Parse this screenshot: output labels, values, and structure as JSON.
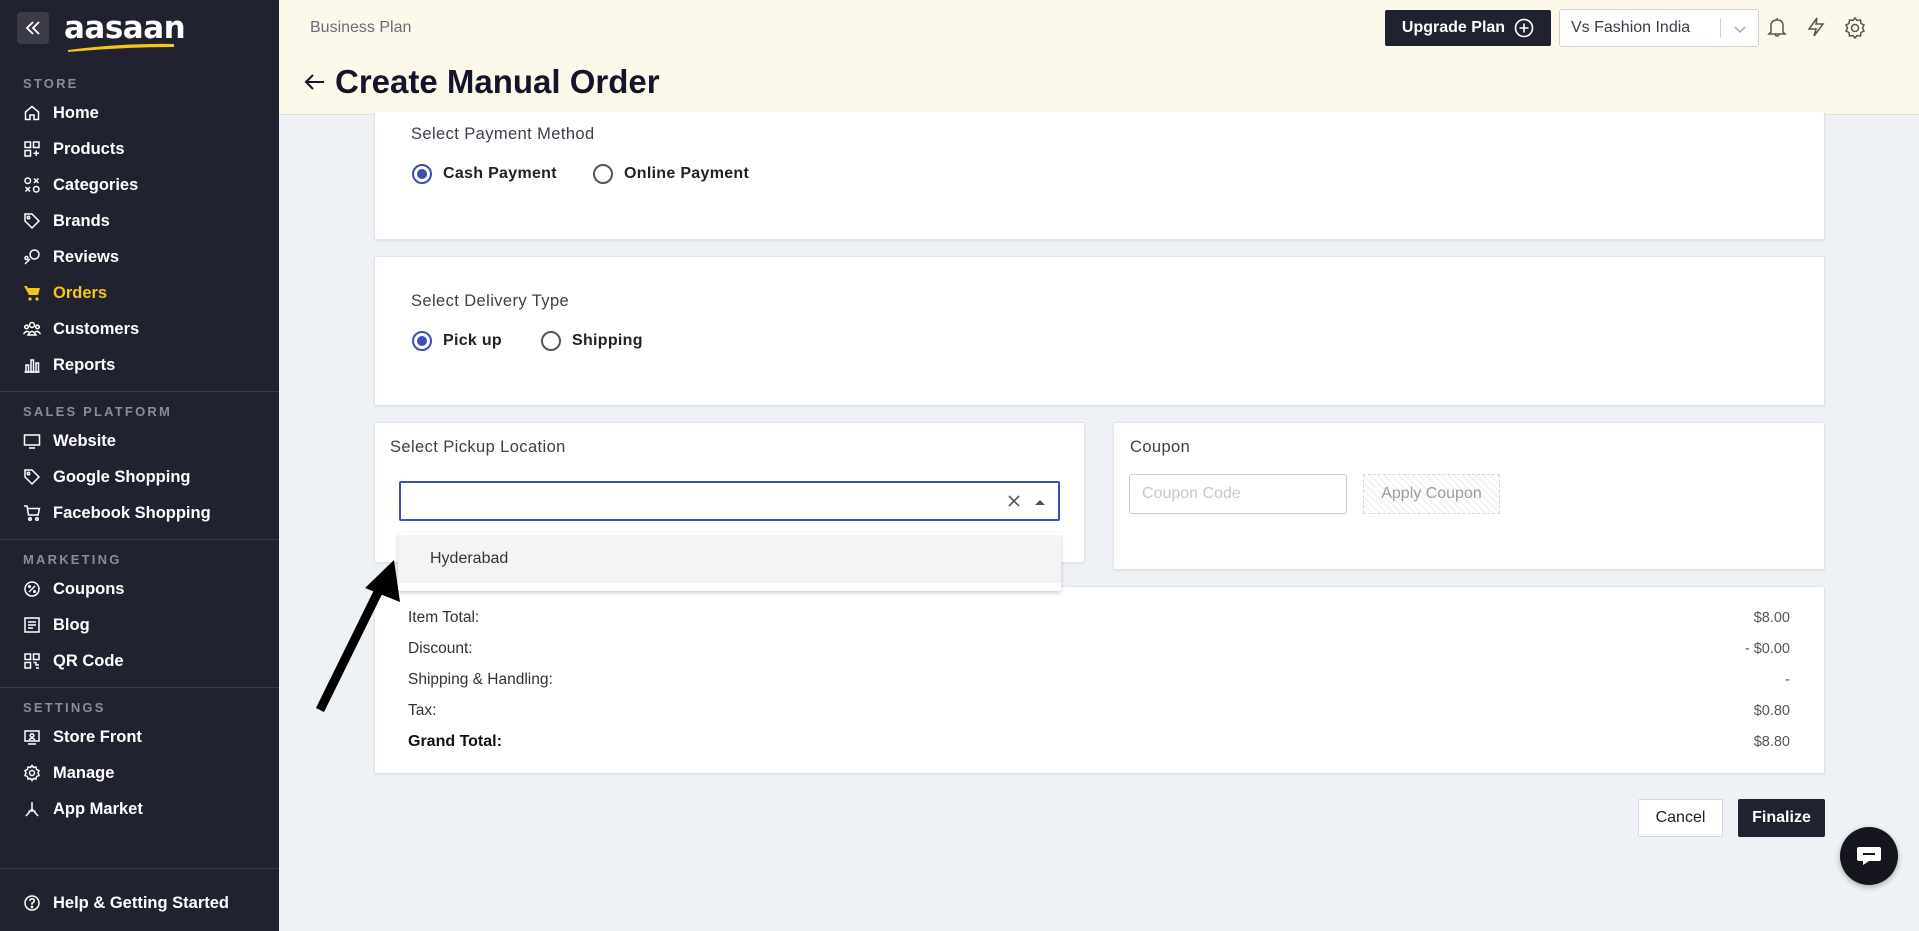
{
  "brand": {
    "logo_text": "aasaan",
    "accent_color": "#f5c518",
    "dark_color": "#21222f"
  },
  "sidebar": {
    "sections": [
      {
        "label": "STORE",
        "items": [
          {
            "label": "Home",
            "icon": "home-icon"
          },
          {
            "label": "Products",
            "icon": "products-icon"
          },
          {
            "label": "Categories",
            "icon": "categories-icon"
          },
          {
            "label": "Brands",
            "icon": "tag-icon"
          },
          {
            "label": "Reviews",
            "icon": "reviews-icon"
          },
          {
            "label": "Orders",
            "icon": "cart-icon",
            "active": true
          },
          {
            "label": "Customers",
            "icon": "customers-icon"
          },
          {
            "label": "Reports",
            "icon": "reports-icon"
          }
        ]
      },
      {
        "label": "SALES PLATFORM",
        "items": [
          {
            "label": "Website",
            "icon": "monitor-icon"
          },
          {
            "label": "Google Shopping",
            "icon": "tag-icon"
          },
          {
            "label": "Facebook Shopping",
            "icon": "cart-icon"
          }
        ]
      },
      {
        "label": "MARKETING",
        "items": [
          {
            "label": "Coupons",
            "icon": "coupon-icon"
          },
          {
            "label": "Blog",
            "icon": "blog-icon"
          },
          {
            "label": "QR Code",
            "icon": "qr-icon"
          }
        ]
      },
      {
        "label": "SETTINGS",
        "items": [
          {
            "label": "Store Front",
            "icon": "storefront-icon"
          },
          {
            "label": "Manage",
            "icon": "gear-icon"
          },
          {
            "label": "App Market",
            "icon": "app-market-icon"
          }
        ]
      }
    ],
    "help_label": "Help & Getting Started"
  },
  "header": {
    "plan_label": "Business Plan",
    "page_title": "Create Manual Order",
    "upgrade_label": "Upgrade Plan",
    "store_name": "Vs Fashion India"
  },
  "payment": {
    "title": "Select Payment Method",
    "options": [
      "Cash Payment",
      "Online Payment"
    ],
    "selected": "Cash Payment"
  },
  "delivery": {
    "title": "Select Delivery Type",
    "options": [
      "Pick up",
      "Shipping"
    ],
    "selected": "Pick up"
  },
  "pickup": {
    "title": "Select Pickup Location",
    "value": "",
    "dropdown_options": [
      "Hyderabad"
    ]
  },
  "coupon": {
    "title": "Coupon",
    "placeholder": "Coupon Code",
    "apply_label": "Apply Coupon"
  },
  "summary": {
    "item_total_label": "Item Total:",
    "item_total": "$8.00",
    "discount_label": "Discount:",
    "discount": "- $0.00",
    "shipping_label": "Shipping & Handling:",
    "shipping": "-",
    "tax_label": "Tax:",
    "tax": "$0.80",
    "grand_total_label": "Grand Total:",
    "grand_total": "$8.80"
  },
  "actions": {
    "cancel_label": "Cancel",
    "finalize_label": "Finalize"
  }
}
